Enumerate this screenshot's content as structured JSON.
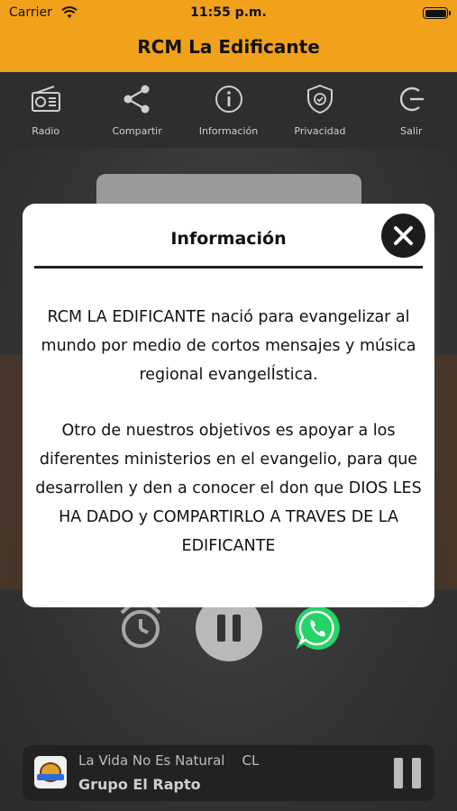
{
  "status_bar": {
    "carrier": "Carrier",
    "time": "11:55 p.m."
  },
  "app": {
    "title": "RCM La Edificante"
  },
  "toolbar": {
    "items": [
      {
        "label": "Radio",
        "icon": "radio-icon"
      },
      {
        "label": "Compartir",
        "icon": "share-icon"
      },
      {
        "label": "Información",
        "icon": "info-icon"
      },
      {
        "label": "Privacidad",
        "icon": "shield-icon"
      },
      {
        "label": "Salir",
        "icon": "exit-icon"
      }
    ]
  },
  "modal": {
    "title": "Información",
    "paragraphs": [
      "RCM LA EDIFICANTE nació para evangelizar al mundo por medio de cortos mensajes y música regional evangelÍstica.",
      "Otro de nuestros objetivos es apoyar a los diferentes ministerios en el evangelio, para que desarrollen y den a conocer el don que DIOS LES HA DADO y COMPARTIRLO A TRAVES DE LA EDIFICANTE"
    ]
  },
  "player": {
    "song": "La Vida No Es Natural    CL",
    "artist": "Grupo El Rapto"
  },
  "colors": {
    "header": "#f2a21a",
    "toolbar": "#2e2e2e",
    "whatsapp": "#25d366"
  }
}
